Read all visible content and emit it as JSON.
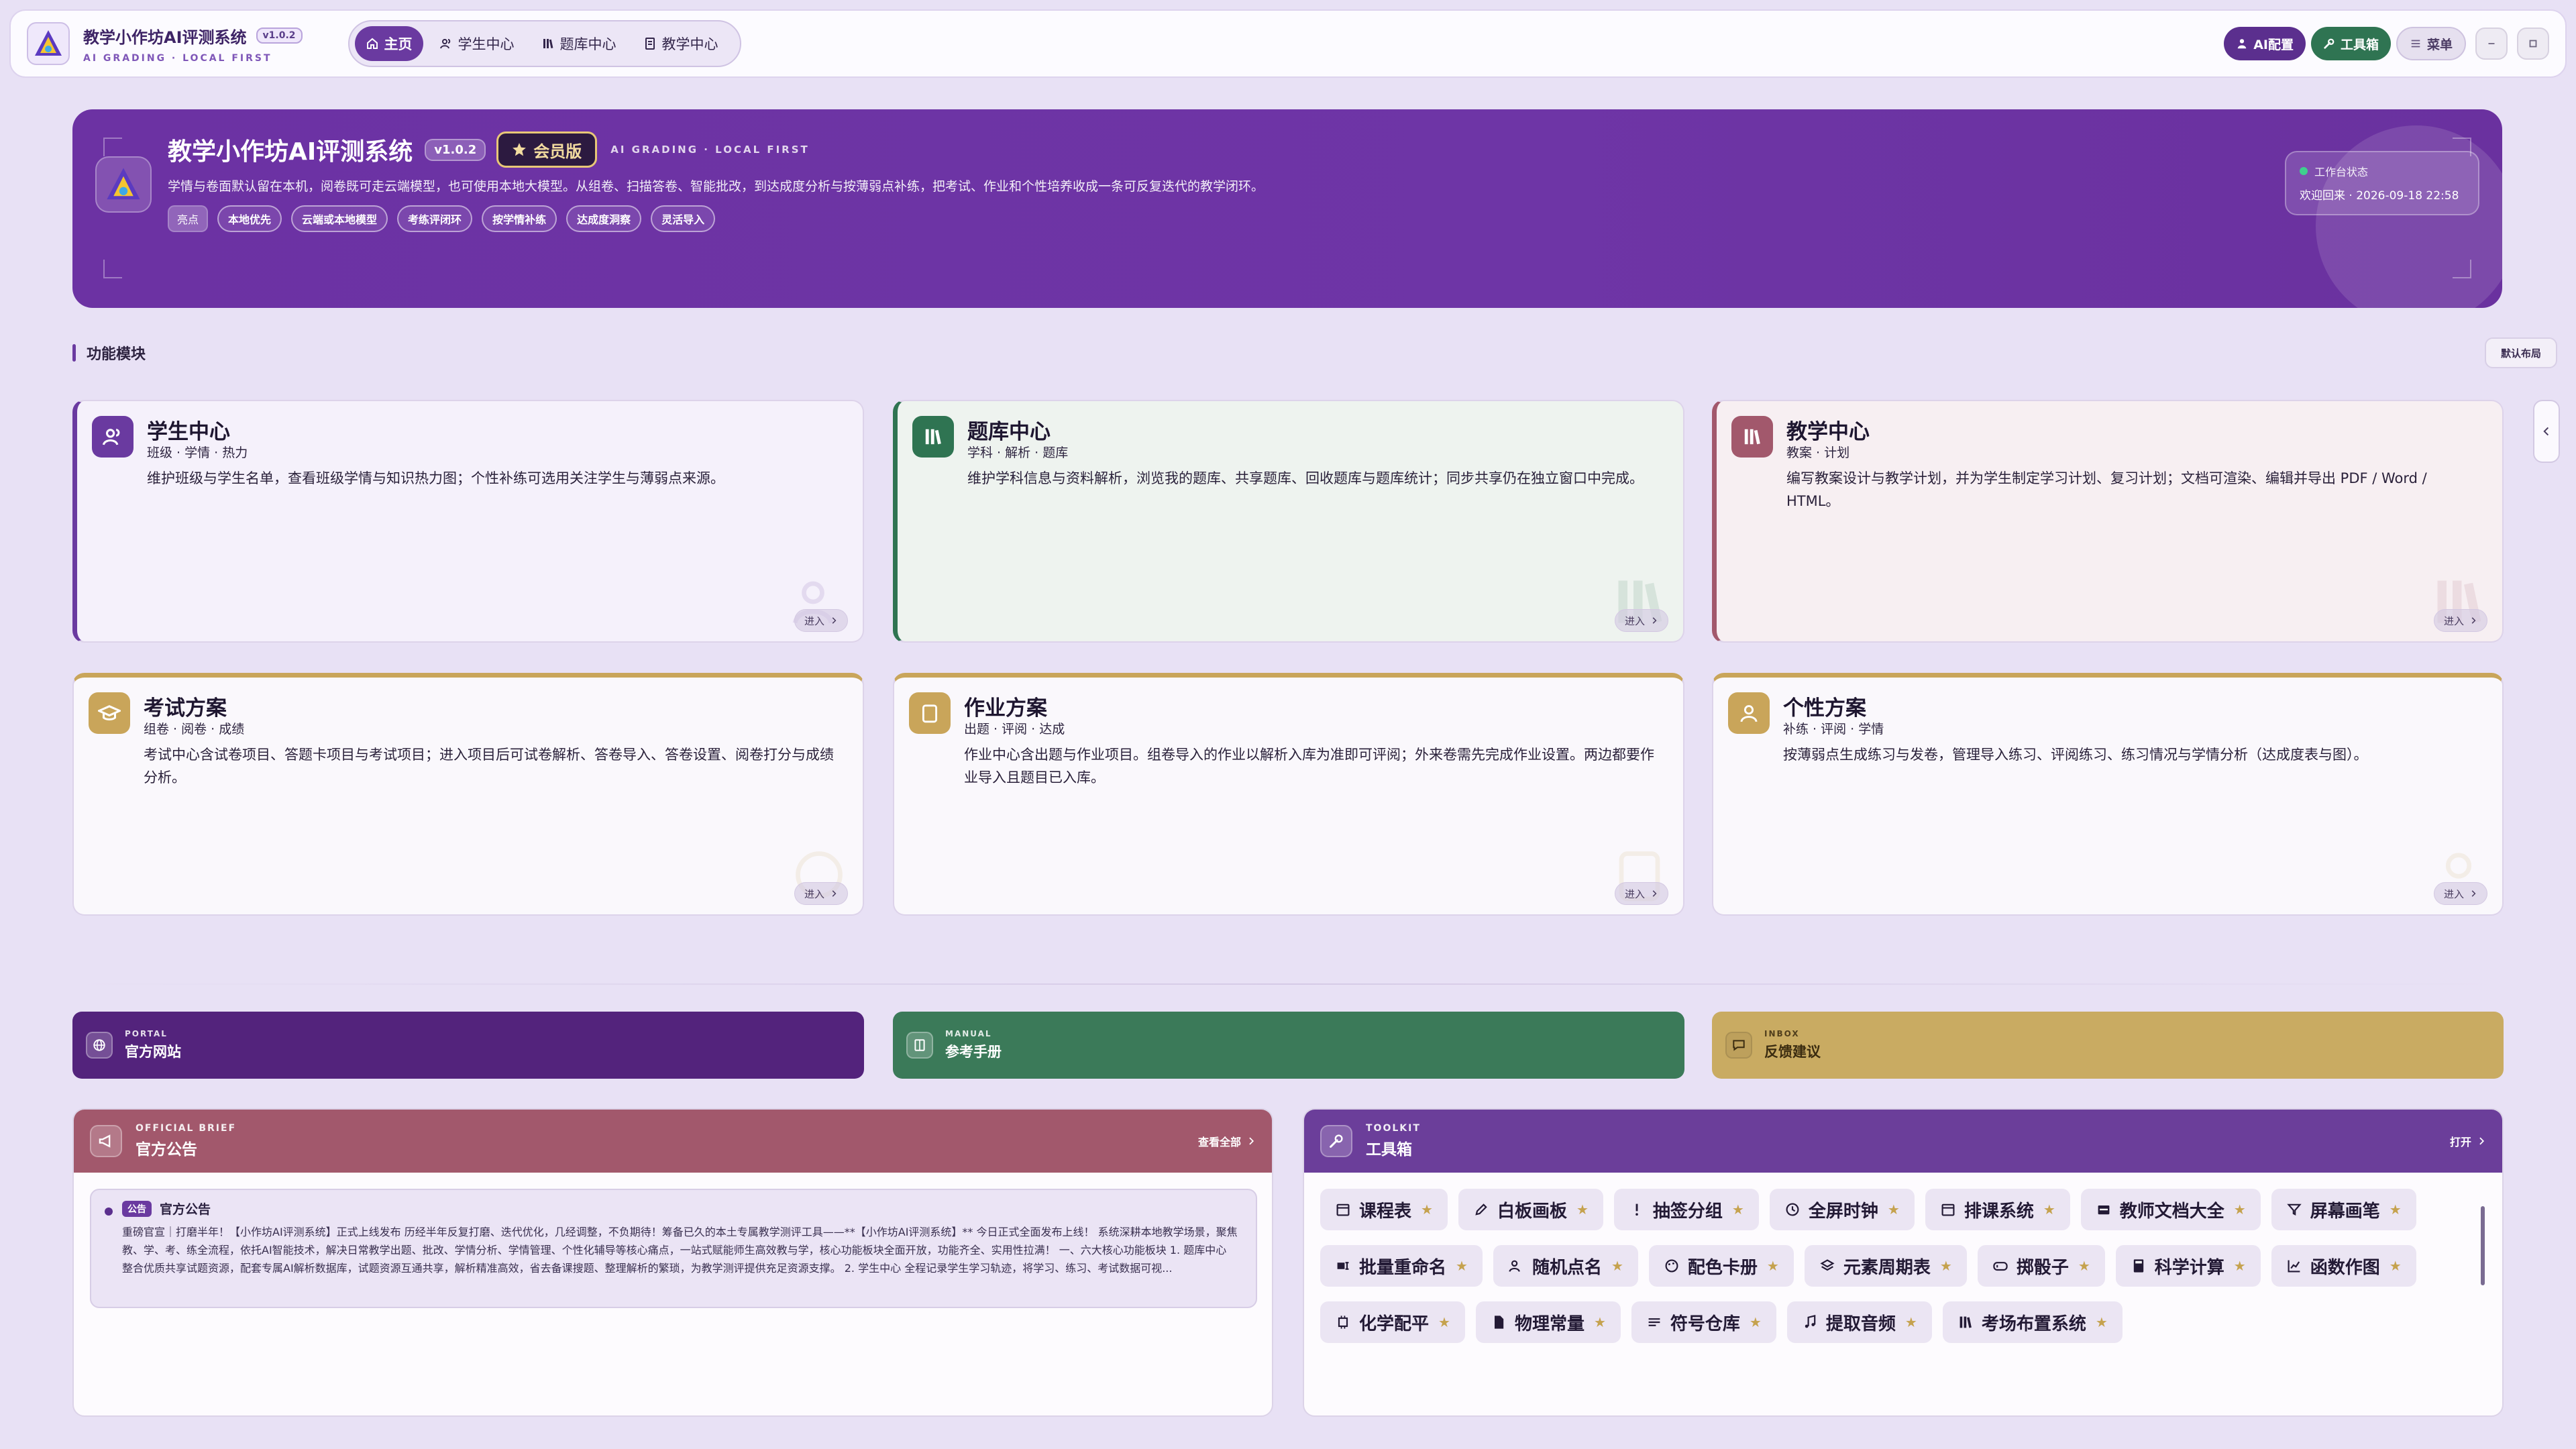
{
  "app": {
    "title": "教学小作坊AI评测系统",
    "version": "v1.0.2",
    "subtitle": "AI GRADING · LOCAL FIRST"
  },
  "nav": {
    "items": [
      {
        "label": "主页",
        "icon": "home-icon",
        "active": true
      },
      {
        "label": "学生中心",
        "icon": "users-icon",
        "active": false
      },
      {
        "label": "题库中心",
        "icon": "books-icon",
        "active": false
      },
      {
        "label": "教学中心",
        "icon": "document-icon",
        "active": false
      }
    ]
  },
  "topbar_actions": {
    "ai_config": "AI配置",
    "toolbox": "工具箱",
    "menu": "菜单"
  },
  "banner": {
    "title": "教学小作坊AI评测系统",
    "version": "v1.0.2",
    "vip_label": "会员版",
    "eng": "AI GRADING · LOCAL FIRST",
    "description": "学情与卷面默认留在本机，阅卷既可走云端模型，也可使用本地大模型。从组卷、扫描答卷、智能批改，到达成度分析与按薄弱点补练，把考试、作业和个性培养收成一条可反复迭代的教学闭环。",
    "tag_lead": "亮点",
    "tags": [
      "本地优先",
      "云端或本地模型",
      "考练评闭环",
      "按学情补练",
      "达成度洞察",
      "灵活导入"
    ],
    "status_label": "工作台状态",
    "status_time": "欢迎回来 · 2026-09-18 22:58"
  },
  "modules_section": {
    "title": "功能模块",
    "reset_label": "默认布局",
    "enter_label": "进入"
  },
  "modules": [
    {
      "title": "学生中心",
      "sub": "班级 · 学情 · 热力",
      "desc": "维护班级与学生名单，查看班级学情与知识热力图；个性补练可选用关注学生与薄弱点来源。",
      "icon": "users-icon",
      "color": "#6a3aa0"
    },
    {
      "title": "题库中心",
      "sub": "学科 · 解析 · 题库",
      "desc": "维护学科信息与资料解析，浏览我的题库、共享题库、回收题库与题库统计；同步共享仍在独立窗口中完成。",
      "icon": "books-icon",
      "color": "#2f7452"
    },
    {
      "title": "教学中心",
      "sub": "教案 · 计划",
      "desc": "编写教案设计与教学计划，并为学生制定学习计划、复习计划；文档可渲染、编辑并导出 PDF / Word / HTML。",
      "icon": "books-icon",
      "color": "#a2586c"
    },
    {
      "title": "考试方案",
      "sub": "组卷 · 阅卷 · 成绩",
      "desc": "考试中心含试卷项目、答题卡项目与考试项目；进入项目后可试卷解析、答卷导入、答卷设置、阅卷打分与成绩分析。",
      "icon": "graduation-cap-icon",
      "color": "#c9a55a"
    },
    {
      "title": "作业方案",
      "sub": "出题 · 评阅 · 达成",
      "desc": "作业中心含出题与作业项目。组卷导入的作业以解析入库为准即可评阅；外来卷需先完成作业设置。两边都要作业导入且题目已入库。",
      "icon": "clipboard-icon",
      "color": "#c9a55a"
    },
    {
      "title": "个性方案",
      "sub": "补练 · 评阅 · 学情",
      "desc": "按薄弱点生成练习与发卷，管理导入练习、评阅练习、练习情况与学情分析（达成度表与图）。",
      "icon": "user-icon",
      "color": "#c9a55a"
    }
  ],
  "link_bars": [
    {
      "eng": "PORTAL",
      "title": "官方网站",
      "icon": "globe-icon",
      "color": "#53237c"
    },
    {
      "eng": "MANUAL",
      "title": "参考手册",
      "icon": "book-icon",
      "color": "#3b7a59"
    },
    {
      "eng": "INBOX",
      "title": "反馈建议",
      "icon": "message-icon",
      "color": "#c9ab62"
    }
  ],
  "notice": {
    "eng": "OFFICIAL BRIEF",
    "title": "官方公告",
    "view_all": "查看全部",
    "item_badge": "公告",
    "item_title": "官方公告",
    "item_body": "重磅官宣｜打磨半年！【小作坊AI评测系统】正式上线发布 历经半年反复打磨、迭代优化，几经调整，不负期待！筹备已久的本土专属教学测评工具——**【小作坊AI评测系统】** 今日正式全面发布上线！ 系统深耕本地教学场景，聚焦教、学、考、练全流程，依托AI智能技术，解决日常教学出题、批改、学情分析、学情管理、个性化辅导等核心痛点，一站式赋能师生高效教与学，核心功能板块全面开放，功能齐全、实用性拉满！ 一、六大核心功能板块 1. 题库中心 整合优质共享试题资源，配套专属AI解析数据库，试题资源互通共享，解析精准高效，省去备课搜题、整理解析的繁琐，为教学测评提供充足资源支撑。 2. 学生中心 全程记录学生学习轨迹，将学习、练习、考试数据可视..."
  },
  "toolkit": {
    "eng": "TOOLKIT",
    "title": "工具箱",
    "open_label": "打开",
    "tools": [
      {
        "label": "课程表",
        "icon": "calendar-icon"
      },
      {
        "label": "白板画板",
        "icon": "pencil-icon"
      },
      {
        "label": "抽签分组",
        "icon": "exclamation-icon"
      },
      {
        "label": "全屏时钟",
        "icon": "clock-icon"
      },
      {
        "label": "排课系统",
        "icon": "calendar-icon"
      },
      {
        "label": "教师文档大全",
        "icon": "folder-icon"
      },
      {
        "label": "屏幕画笔",
        "icon": "filter-icon"
      },
      {
        "label": "批量重命名",
        "icon": "rename-icon"
      },
      {
        "label": "随机点名",
        "icon": "user-pick-icon"
      },
      {
        "label": "配色卡册",
        "icon": "palette-icon"
      },
      {
        "label": "元素周期表",
        "icon": "layers-icon"
      },
      {
        "label": "掷骰子",
        "icon": "gamepad-icon"
      },
      {
        "label": "科学计算",
        "icon": "calculator-icon"
      },
      {
        "label": "函数作图",
        "icon": "chart-icon"
      },
      {
        "label": "化学配平",
        "icon": "chip-icon"
      },
      {
        "label": "物理常量",
        "icon": "doc-icon"
      },
      {
        "label": "符号仓库",
        "icon": "list-icon"
      },
      {
        "label": "提取音频",
        "icon": "music-icon"
      },
      {
        "label": "考场布置系统",
        "icon": "books-icon"
      }
    ],
    "star": "★"
  }
}
